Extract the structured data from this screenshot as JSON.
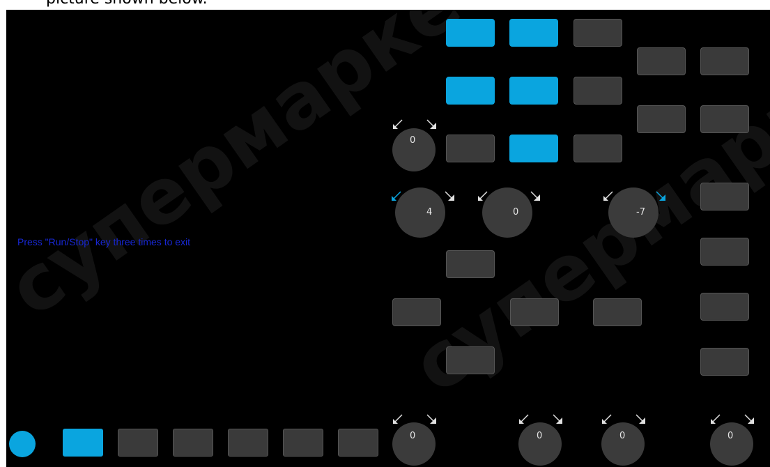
{
  "caption": "picture shown below.",
  "message": "Press \"Run/Stop\" key three times to exit",
  "watermark": "супермаркет",
  "knobs": {
    "k1": "0",
    "k2": "4",
    "k3": "0",
    "k4": "-7",
    "bk1": "0",
    "bk2": "0",
    "bk3": "0",
    "bk4": "0"
  },
  "colors": {
    "accent": "#0aa5df",
    "button": "#3a3a3a",
    "message": "#1727d4",
    "background": "#000000"
  }
}
